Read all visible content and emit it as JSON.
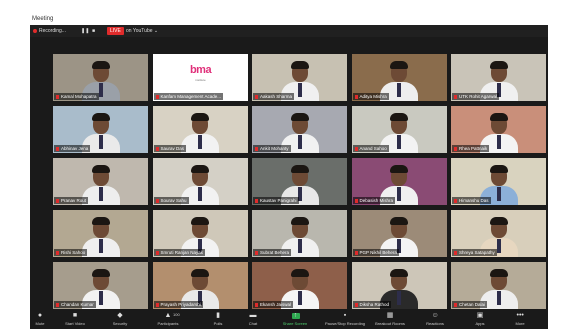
{
  "window": {
    "title": "Meeting"
  },
  "topbar": {
    "recording": "Recording...",
    "live_badge": "LIVE",
    "live_target": "on YouTube"
  },
  "participants": [
    {
      "name": "Kamal Mohapatra",
      "bg": "#9c9486",
      "shirt": "#9aa0a8",
      "active": true
    },
    {
      "name": "Kanfam Management Acade...",
      "logo": "bma",
      "logo_sub": "institute"
    },
    {
      "name": "Aakash Sharma",
      "bg": "#c7c1b2",
      "shirt": "#f0f0f0"
    },
    {
      "name": "Aditya Mishra",
      "bg": "#8a6c4c",
      "shirt": "#eeeeee"
    },
    {
      "name": "UTK Rohit Agarwal",
      "bg": "#c9c4b8",
      "shirt": "#f0f0f0"
    },
    {
      "name": "Abhinav Jena",
      "bg": "#a9bccb",
      "shirt": "#eaeaea"
    },
    {
      "name": "Saurav Das",
      "bg": "#d8d2c4",
      "shirt": "#f2f2f2"
    },
    {
      "name": "Ankit Mohanty",
      "bg": "#a7a9b1",
      "shirt": "#f1f1f1"
    },
    {
      "name": "Anand Sahoo",
      "bg": "#c9c9c0",
      "shirt": "#f3f3f3"
    },
    {
      "name": "Rhea Pattnaik",
      "bg": "#c98f7a",
      "shirt": "#f4f4f4"
    },
    {
      "name": "Pranav Rout",
      "bg": "#bfb8ae",
      "shirt": "#eeeeee"
    },
    {
      "name": "Sourav Sahu",
      "bg": "#d4d0c6",
      "shirt": "#f2f2f2"
    },
    {
      "name": "Kaustav Panigrahi",
      "bg": "#6a6e6a",
      "shirt": "#e8e8e8"
    },
    {
      "name": "Debasish Mishra",
      "bg": "#8a4b74",
      "shirt": "#f0f0f0"
    },
    {
      "name": "Himanshu Das",
      "bg": "#d9d3bf",
      "shirt": "#8cb0d8"
    },
    {
      "name": "Rishi Sahoo",
      "bg": "#b3a892",
      "shirt": "#efefef"
    },
    {
      "name": "Smruti Ranjan Nayak",
      "bg": "#cfc8b9",
      "shirt": "#f2f2f2"
    },
    {
      "name": "Subrat Behera",
      "bg": "#b9b7ae",
      "shirt": "#f0f0f0"
    },
    {
      "name": "PGP Nikhil Behera",
      "bg": "#9c8b78",
      "shirt": "#f4f4f4"
    },
    {
      "name": "Shreya Satapathy",
      "bg": "#d8cfbb",
      "shirt": "#e7d7c0"
    },
    {
      "name": "Chandan Kumar",
      "bg": "#a69d8d",
      "shirt": "#f2f2f2"
    },
    {
      "name": "Prayash Priyadarshi",
      "bg": "#b38f6e",
      "shirt": "#e9e9e9"
    },
    {
      "name": "Ekansh Jaiswal",
      "bg": "#8e5f4a",
      "shirt": "#f5f5f5"
    },
    {
      "name": "Diksha Rathod",
      "bg": "#cdc6b8",
      "shirt": "#2a2a2a"
    },
    {
      "name": "Chetan Dalai",
      "bg": "#b5ab98",
      "shirt": "#eeeeee"
    }
  ],
  "toolbar": [
    {
      "key": "mute",
      "icon": "●",
      "label": "Mute"
    },
    {
      "key": "video",
      "icon": "■",
      "label": "Start Video"
    },
    {
      "key": "security",
      "icon": "◆",
      "label": "Security"
    },
    {
      "key": "participants",
      "icon": "▲",
      "label": "Participants",
      "count": "100"
    },
    {
      "key": "polls",
      "icon": "▮",
      "label": "Polls"
    },
    {
      "key": "chat",
      "icon": "▬",
      "label": "Chat"
    },
    {
      "key": "share",
      "icon": "↑",
      "label": "Share Screen"
    },
    {
      "key": "record",
      "icon": "▪",
      "label": "Pause/Stop Recording"
    },
    {
      "key": "breakout",
      "icon": "▦",
      "label": "Breakout Rooms"
    },
    {
      "key": "reactions",
      "icon": "☺",
      "label": "Reactions"
    },
    {
      "key": "apps",
      "icon": "▣",
      "label": "Apps"
    },
    {
      "key": "more",
      "icon": "•••",
      "label": "More"
    }
  ]
}
